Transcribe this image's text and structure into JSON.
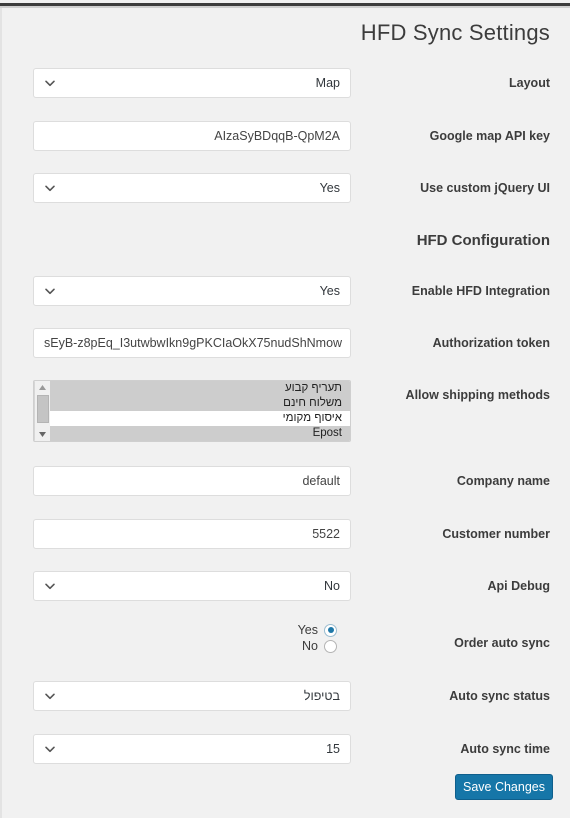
{
  "page": {
    "title": "HFD Sync Settings"
  },
  "sections": {
    "hfd_configuration": "HFD Configuration"
  },
  "fields": {
    "layout": {
      "label": "Layout",
      "type": "select",
      "value": "Map"
    },
    "google_map_api_key": {
      "label": "Google map API key",
      "type": "text",
      "value": "AIzaSyBDqqB-QpM2A"
    },
    "use_custom_jquery_ui": {
      "label": "Use custom jQuery UI",
      "type": "select",
      "value": "Yes"
    },
    "enable_hfd_integration": {
      "label": "Enable HFD Integration",
      "type": "select",
      "value": "Yes"
    },
    "authorization_token": {
      "label": "Authorization token",
      "type": "text",
      "value": "sEyB-z8pEq_I3utwbwIkn9gPKCIaOkX75nudShNmow"
    },
    "allow_shipping_methods": {
      "label": "Allow shipping methods",
      "type": "multiselect",
      "options": [
        {
          "label": "תעריף קבוע",
          "selected": true,
          "ltr": false
        },
        {
          "label": "משלוח חינם",
          "selected": true,
          "ltr": false
        },
        {
          "label": "איסוף מקומי",
          "selected": false,
          "ltr": false
        },
        {
          "label": "Epost",
          "selected": true,
          "ltr": true
        }
      ]
    },
    "company_name": {
      "label": "Company name",
      "type": "text",
      "value": "default"
    },
    "customer_number": {
      "label": "Customer number",
      "type": "text",
      "value": "5522"
    },
    "api_debug": {
      "label": "Api Debug",
      "type": "select",
      "value": "No"
    },
    "order_auto_sync": {
      "label": "Order auto sync",
      "type": "radio",
      "options": [
        {
          "label": "Yes",
          "checked": true
        },
        {
          "label": "No",
          "checked": false
        }
      ]
    },
    "auto_sync_status": {
      "label": "Auto sync status",
      "type": "select",
      "value": "בטיפול"
    },
    "auto_sync_time": {
      "label": "Auto sync time",
      "type": "select",
      "value": "15"
    }
  },
  "actions": {
    "save_changes": "Save Changes"
  },
  "colors": {
    "accent": "#1676a8",
    "radio_selected": "#1f78a8",
    "background": "#f1f1f1",
    "text": "#3c3c3c"
  },
  "icons": {
    "chevron_down": "chevron-down-icon",
    "scroll_up": "scroll-up-arrow-icon",
    "scroll_down": "scroll-down-arrow-icon"
  }
}
